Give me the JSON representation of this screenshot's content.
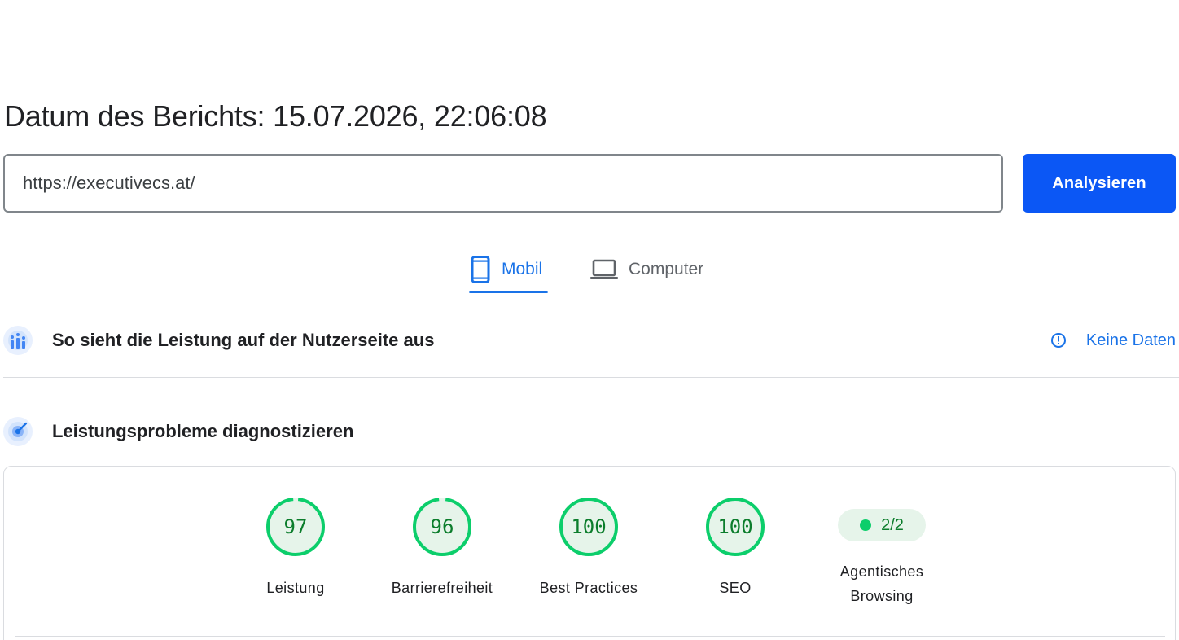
{
  "report": {
    "date_label": "Datum des Berichts: 15.07.2026, 22:06:08"
  },
  "url_input": {
    "value": "https://executivecs.at/"
  },
  "analyze_button": {
    "label": "Analysieren"
  },
  "tabs": [
    {
      "label": "Mobil",
      "icon": "smartphone-icon",
      "active": true
    },
    {
      "label": "Computer",
      "icon": "laptop-icon",
      "active": false
    }
  ],
  "field_data": {
    "title": "So sieht die Leistung auf der Nutzerseite aus",
    "status": "Keine Daten",
    "icon": "field-data-icon"
  },
  "lab_data": {
    "title": "Leistungsprobleme diagnostizieren",
    "icon": "lab-data-icon"
  },
  "scores": [
    {
      "value": 97,
      "label": "Leistung"
    },
    {
      "value": 96,
      "label": "Barrierefreiheit"
    },
    {
      "value": 100,
      "label": "Best Practices"
    },
    {
      "value": 100,
      "label": "SEO"
    }
  ],
  "agentic": {
    "value": "2/2",
    "label_line1": "Agentisches",
    "label_line2": "Browsing"
  },
  "colors": {
    "accent": "#1a73e8",
    "button": "#0b57f5",
    "score_good": "#0cce6b",
    "score_text": "#0c7d2c",
    "score_fill": "#e6f4ea"
  }
}
